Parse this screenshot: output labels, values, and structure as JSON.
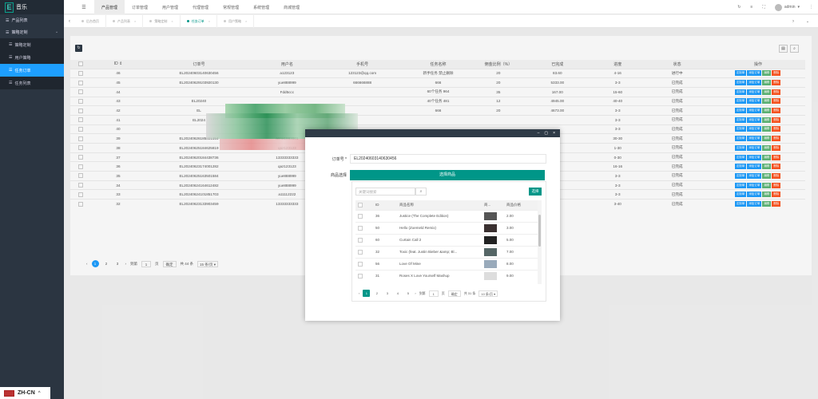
{
  "app": {
    "logo_letter": "E",
    "title": "音乐"
  },
  "sidebar": {
    "items": [
      {
        "label": "产品列表",
        "expanded": false
      },
      {
        "label": "策略定制",
        "expanded": true,
        "children": [
          {
            "label": "策略定制",
            "active": false
          },
          {
            "label": "用户策略",
            "active": false
          },
          {
            "label": "任务订单",
            "active": true
          },
          {
            "label": "任务列表",
            "active": false
          }
        ]
      }
    ]
  },
  "language": {
    "label": "ZH-CN",
    "chevron": "^"
  },
  "topnav": {
    "items": [
      "产品管理",
      "订单管理",
      "用户管理",
      "代理管理",
      "常规管理",
      "系统管理",
      "商城管理"
    ],
    "active": 0,
    "user": "admin"
  },
  "tabs": {
    "items": [
      {
        "label": "后台首页",
        "active": false
      },
      {
        "label": "产品列表",
        "active": false
      },
      {
        "label": "策略定制",
        "active": false
      },
      {
        "label": "任务订单",
        "active": true
      },
      {
        "label": "用户策略",
        "active": false
      }
    ]
  },
  "table": {
    "headers": [
      "ID",
      "订单号",
      "用户名",
      "手机号",
      "任务名称",
      "佣金比例（%）",
      "已完成",
      "进度",
      "状态",
      "操作"
    ],
    "actions": [
      "定制单",
      "添加订单",
      "编辑",
      "删除"
    ],
    "rows": [
      {
        "id": "46",
        "order": "EL20240603140630456",
        "user": "a123123",
        "phone": "123123@qq.com",
        "task": "新手任务 禁止删除",
        "ratio": "20",
        "done": "83.60",
        "progress": "4-16",
        "status": "进行中"
      },
      {
        "id": "45",
        "order": "EL20240629103920130",
        "user": "yue888999",
        "phone": "666666888",
        "task": "666",
        "ratio": "20",
        "done": "5333.00",
        "progress": "3-3",
        "status": "已完成"
      },
      {
        "id": "44",
        "order": "",
        "user": "Fdd5ccc",
        "phone": "",
        "task": "60个任务 964",
        "ratio": "35",
        "done": "167.00",
        "progress": "15-60",
        "status": "已完成"
      },
      {
        "id": "43",
        "order": "EL20240",
        "user": "",
        "phone": "",
        "task": "40个任务 481",
        "ratio": "12",
        "done": "4945.00",
        "progress": "40-40",
        "status": "已完成"
      },
      {
        "id": "42",
        "order": "EL",
        "user": "",
        "phone": "",
        "task": "666",
        "ratio": "20",
        "done": "4673.00",
        "progress": "3-3",
        "status": "已完成"
      },
      {
        "id": "41",
        "order": "EL2024",
        "user": "",
        "phone": "",
        "task": "",
        "ratio": "",
        "done": "",
        "progress": "3-3",
        "status": "已完成"
      },
      {
        "id": "40",
        "order": "",
        "user": "",
        "phone": "",
        "task": "",
        "ratio": "",
        "done": "",
        "progress": "3-3",
        "status": "已完成"
      },
      {
        "id": "39",
        "order": "EL20240626185801354",
        "user": "anna1993001",
        "phone": "",
        "task": "",
        "ratio": "",
        "done": "",
        "progress": "30-30",
        "status": "已完成"
      },
      {
        "id": "38",
        "order": "EL20240625184625819",
        "user": "qaz123123",
        "phone": "",
        "task": "",
        "ratio": "",
        "done": "",
        "progress": "1-30",
        "status": "已完成"
      },
      {
        "id": "37",
        "order": "EL20240620184438736",
        "user": "13333333333",
        "phone": "",
        "task": "",
        "ratio": "",
        "done": "",
        "progress": "0-30",
        "status": "已完成"
      },
      {
        "id": "36",
        "order": "EL20240623174001282",
        "user": "qaz123123",
        "phone": "",
        "task": "",
        "ratio": "",
        "done": "",
        "progress": "16-16",
        "status": "已完成"
      },
      {
        "id": "35",
        "order": "EL20240625163501584",
        "user": "yue888999",
        "phone": "",
        "task": "",
        "ratio": "",
        "done": "",
        "progress": "3-3",
        "status": "已完成"
      },
      {
        "id": "34",
        "order": "EL20240624164612482",
        "user": "yue888999",
        "phone": "",
        "task": "",
        "ratio": "",
        "done": "",
        "progress": "3-3",
        "status": "已完成"
      },
      {
        "id": "33",
        "order": "EL20240624101851703",
        "user": "a11112222",
        "phone": "",
        "task": "",
        "ratio": "",
        "done": "",
        "progress": "3-3",
        "status": "已完成"
      },
      {
        "id": "32",
        "order": "EL20240623133903459",
        "user": "13333333333",
        "phone": "",
        "task": "",
        "ratio": "",
        "done": "",
        "progress": "3-40",
        "status": "已完成"
      }
    ]
  },
  "pager": {
    "pages": [
      "1",
      "2",
      "3"
    ],
    "goto_label": "到第",
    "page_value": "1",
    "page_suffix": "页",
    "confirm": "确定",
    "total": "共 44 条",
    "per_page": "15 条/页"
  },
  "modal": {
    "order_label": "订单号",
    "order_value": "EL20240603140630456",
    "product_label": "商品选择",
    "select_bar": "选择商品",
    "search_placeholder": "关键词搜索",
    "pick_button": "选择",
    "headers": [
      "ID",
      "商品名称",
      "商...",
      "商品价格"
    ],
    "rows": [
      {
        "id": "36",
        "name": "Justice (The Complete Edition)",
        "price": "2.00",
        "thumb": "#555"
      },
      {
        "id": "50",
        "name": "Hello (Zoemeld Remix)",
        "price": "3.00",
        "thumb": "#3a3030"
      },
      {
        "id": "60",
        "name": "Curtain Call 2",
        "price": "5.00",
        "thumb": "#222"
      },
      {
        "id": "32",
        "name": "Toxic (feat. Justin Bieber &amp; Bl...",
        "price": "7.00",
        "thumb": "#566"
      },
      {
        "id": "56",
        "name": "Love Of Mine",
        "price": "8.00",
        "thumb": "#9ab"
      },
      {
        "id": "31",
        "name": "Roses X Love Yourself Mashup",
        "price": "9.00",
        "thumb": "#ddd"
      }
    ],
    "pager": {
      "pages": [
        "1",
        "2",
        "3",
        "4",
        "5"
      ],
      "goto_label": "到第",
      "page_value": "1",
      "page_suffix": "页",
      "confirm": "确定",
      "total": "共 31 条",
      "per_page": "10 条/页"
    }
  },
  "colors": {
    "sidebar": "#2b3541",
    "accent": "#1e9fff",
    "teal": "#009688",
    "green": "#5fb878",
    "red": "#ff5722"
  }
}
